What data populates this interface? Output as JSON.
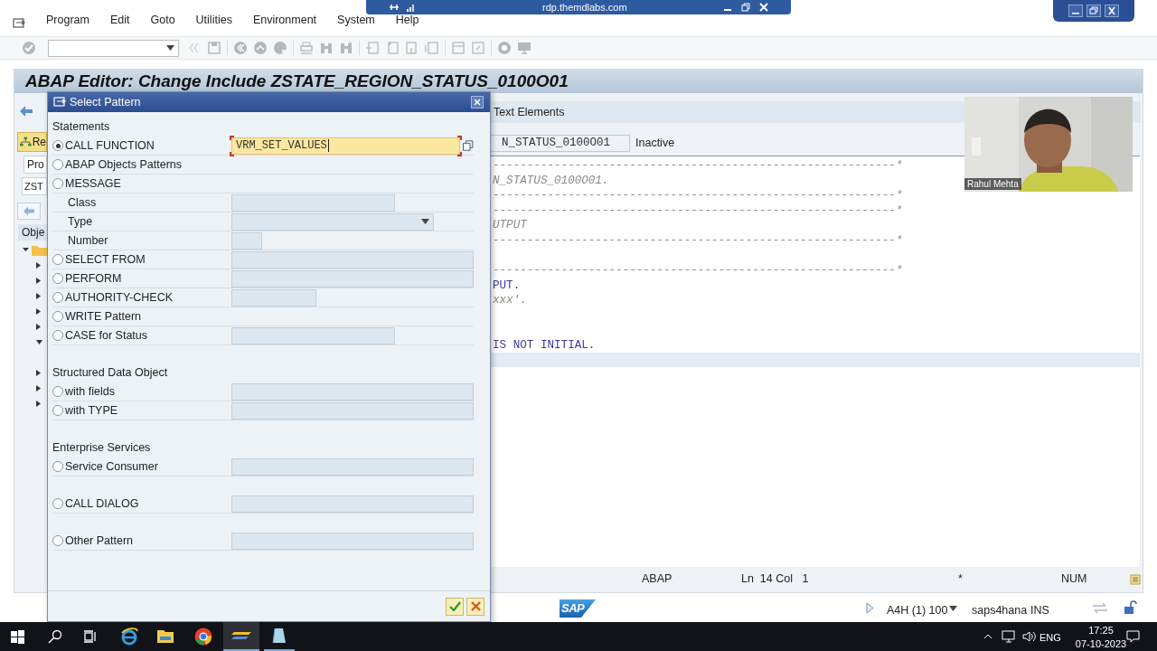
{
  "remote_bar": {
    "title": "rdp.themdlabs.com"
  },
  "menu": [
    "Program",
    "Edit",
    "Goto",
    "Utilities",
    "Environment",
    "System",
    "Help"
  ],
  "window_title": "ABAP Editor: Change Include ZSTATE_REGION_STATUS_0100O01",
  "app_toolbar": {
    "text_elements": "Text Elements"
  },
  "left_panel": {
    "button": "Re",
    "field_1": "Pro",
    "field_2": "ZST",
    "header": "Obje"
  },
  "include_field": {
    "value": "N_STATUS_0100O01",
    "status": "Inactive"
  },
  "code_lines": [
    {
      "kind": "comment",
      "text": "-----------------------------------------------------------*",
      "current": false
    },
    {
      "kind": "comment",
      "text": "N_STATUS_0100O01.",
      "current": false
    },
    {
      "kind": "comment",
      "text": "-----------------------------------------------------------*",
      "current": false
    },
    {
      "kind": "comment",
      "text": "-----------------------------------------------------------*",
      "current": false
    },
    {
      "kind": "comment",
      "text": "UTPUT",
      "current": false
    },
    {
      "kind": "comment",
      "text": "-----------------------------------------------------------*",
      "current": false
    },
    {
      "kind": "blank",
      "current": false
    },
    {
      "kind": "comment",
      "text": "-----------------------------------------------------------*",
      "current": false
    },
    {
      "kind": "code",
      "text": "PUT.",
      "current": false
    },
    {
      "kind": "comment",
      "text": "xxx'.",
      "current": false
    },
    {
      "kind": "blank",
      "current": false
    },
    {
      "kind": "blank",
      "current": false
    },
    {
      "kind": "code",
      "text": "IS NOT INITIAL.",
      "current": false
    },
    {
      "kind": "blank",
      "current": true
    }
  ],
  "webcam": {
    "kind": "picture",
    "name": "Rahul Mehta"
  },
  "status_bar": {
    "language": "ABAP",
    "position": "Ln  14 Col   1",
    "modified": "*",
    "num": "NUM"
  },
  "system_bar": {
    "logo": "SAP",
    "system": "A4H (1) 100",
    "server": "saps4hana",
    "mode": "INS"
  },
  "dialog": {
    "title": "Select Pattern",
    "sections": [
      {
        "heading": "Statements",
        "rows": [
          {
            "kind": "radio",
            "label": "CALL FUNCTION",
            "selected": true,
            "field": {
              "kind": "wide",
              "value": "VRM_SET_VALUES"
            }
          },
          {
            "kind": "radio",
            "label": "ABAP Objects Patterns",
            "selected": false
          },
          {
            "kind": "radio",
            "label": "MESSAGE",
            "selected": false
          },
          {
            "kind": "label",
            "label": "Class",
            "field": {
              "kind": "medium"
            }
          },
          {
            "kind": "label",
            "label": "Type",
            "field": {
              "kind": "dropdown"
            }
          },
          {
            "kind": "label",
            "label": "Number",
            "field": {
              "kind": "tiny"
            }
          },
          {
            "kind": "radio",
            "label": "SELECT FROM",
            "selected": false,
            "field": {
              "kind": "wide"
            }
          },
          {
            "kind": "radio",
            "label": "PERFORM",
            "selected": false,
            "field": {
              "kind": "wide"
            }
          },
          {
            "kind": "radio",
            "label": "AUTHORITY-CHECK",
            "selected": false,
            "field": {
              "kind": "short"
            }
          },
          {
            "kind": "radio",
            "label": "WRITE Pattern",
            "selected": false
          },
          {
            "kind": "radio",
            "label": "CASE for Status",
            "selected": false,
            "field": {
              "kind": "medium"
            }
          }
        ]
      },
      {
        "heading": "Structured Data Object",
        "rows": [
          {
            "kind": "radio",
            "label": "with fields",
            "selected": false,
            "field": {
              "kind": "wide"
            }
          },
          {
            "kind": "radio",
            "label": "with TYPE",
            "selected": false,
            "field": {
              "kind": "wide"
            }
          }
        ]
      },
      {
        "heading": "Enterprise Services",
        "rows": [
          {
            "kind": "radio",
            "label": "Service Consumer",
            "selected": false,
            "field": {
              "kind": "wide"
            }
          },
          {
            "kind": "radio",
            "label": "CALL DIALOG",
            "selected": false,
            "field": {
              "kind": "wide"
            }
          },
          {
            "kind": "radio",
            "label": "Other Pattern",
            "selected": false,
            "field": {
              "kind": "wide"
            }
          }
        ]
      }
    ]
  },
  "taskbar": {
    "language": "ENG",
    "time": "17:25",
    "date": "07-10-2023"
  }
}
